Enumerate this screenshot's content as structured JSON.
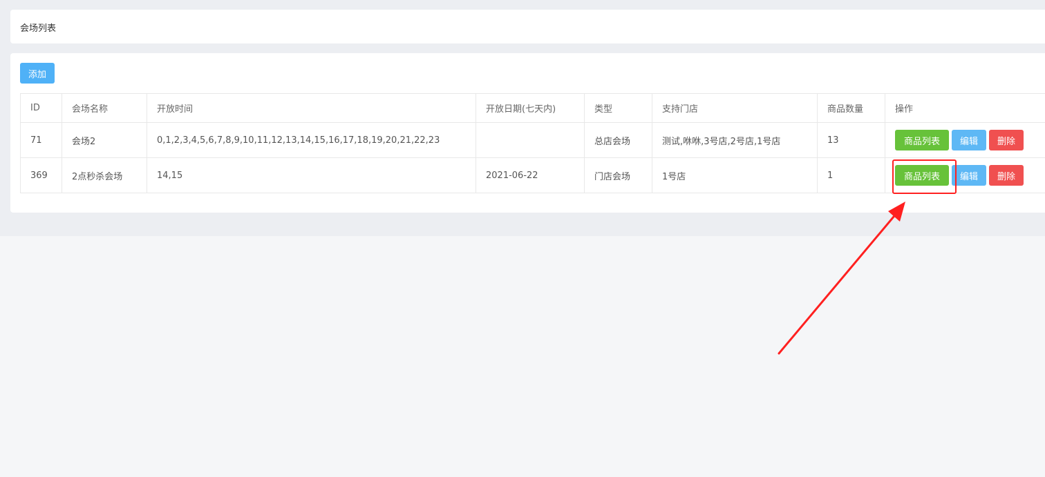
{
  "page": {
    "title": "会场列表"
  },
  "toolbar": {
    "add_label": "添加"
  },
  "table": {
    "headers": [
      "ID",
      "会场名称",
      "开放时间",
      "开放日期(七天内)",
      "类型",
      "支持门店",
      "商品数量",
      "操作"
    ],
    "rows": [
      {
        "id": "71",
        "name": "会场2",
        "open_time": "0,1,2,3,4,5,6,7,8,9,10,11,12,13,14,15,16,17,18,19,20,21,22,23",
        "open_date": "",
        "type": "总店会场",
        "stores": "测试,咻咻,3号店,2号店,1号店",
        "goods_count": "13"
      },
      {
        "id": "369",
        "name": "2点秒杀会场",
        "open_time": "14,15",
        "open_date": "2021-06-22",
        "type": "门店会场",
        "stores": "1号店",
        "goods_count": "1"
      }
    ],
    "actions": {
      "goods_label": "商品列表",
      "edit_label": "编辑",
      "delete_label": "删除"
    }
  },
  "colors": {
    "green": "#67c23a",
    "blue": "#5eb8f5",
    "red": "#f05050",
    "annotation": "#ff2020"
  }
}
